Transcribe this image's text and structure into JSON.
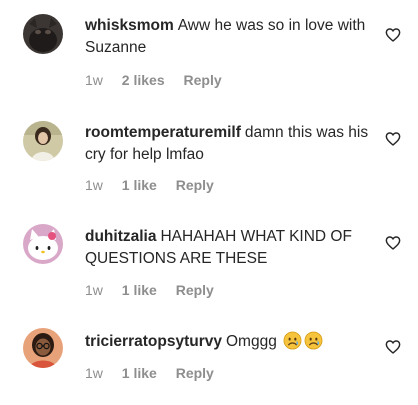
{
  "comments": [
    {
      "username": "whisksmom",
      "text": "Aww he was so in love with Suzanne",
      "time": "1w",
      "likes": "2 likes",
      "reply": "Reply",
      "avatar_icon": "dark-cat-avatar",
      "like_icon": "heart-outline-icon"
    },
    {
      "username": "roomtemperaturemilf",
      "text": "damn this was his cry for help lmfao",
      "time": "1w",
      "likes": "1 like",
      "reply": "Reply",
      "avatar_icon": "portrait-avatar",
      "like_icon": "heart-outline-icon"
    },
    {
      "username": "duhitzalia",
      "text": "HAHAHAH WHAT KIND OF QUESTIONS ARE THESE",
      "time": "1w",
      "likes": "1 like",
      "reply": "Reply",
      "avatar_icon": "hello-kitty-avatar",
      "like_icon": "heart-outline-icon"
    },
    {
      "username": "tricierratopsyturvy",
      "text": "Omggg",
      "emojis": [
        "sad-face-emoji",
        "sad-face-emoji"
      ],
      "time": "1w",
      "likes": "1 like",
      "reply": "Reply",
      "avatar_icon": "person-glasses-avatar",
      "like_icon": "heart-outline-icon"
    }
  ],
  "colors": {
    "text": "#262626",
    "meta": "#8e8e8e",
    "background": "#ffffff"
  }
}
